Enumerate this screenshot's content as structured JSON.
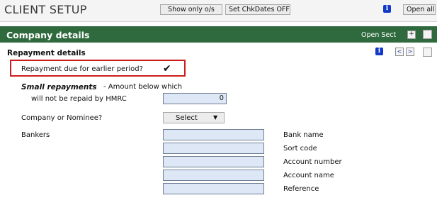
{
  "header": {
    "title": "CLIENT SETUP",
    "show_only_label": "Show only o/s",
    "set_chkdates_label": "Set ChkDates OFF",
    "info_glyph": "i",
    "open_all_label": "Open all"
  },
  "section": {
    "title": "Company details",
    "open_sect_label": "Open Sect",
    "expand_glyph": "+",
    "accent_color": "#2f6a3e"
  },
  "repayment": {
    "title": "Repayment details",
    "info_glyph": "i",
    "prev_glyph": "<",
    "next_glyph": ">",
    "due_label": "Repayment due for earlier period?",
    "due_checked": true,
    "check_glyph": "✔",
    "small_title": "Small repayments",
    "small_desc_line1": "-  Amount below which",
    "small_desc_line2": "will not be repaid by HMRC",
    "small_value": "0",
    "company_label": "Company or Nominee?",
    "select_value": "Select",
    "select_arrow": "▼",
    "bankers_label": "Bankers",
    "bank_fields": [
      {
        "label": "Bank name",
        "value": ""
      },
      {
        "label": "Sort code",
        "value": ""
      },
      {
        "label": "Account number",
        "value": ""
      },
      {
        "label": "Account name",
        "value": ""
      },
      {
        "label": "Reference",
        "value": ""
      }
    ],
    "highlight_color": "#cc1e1e"
  }
}
